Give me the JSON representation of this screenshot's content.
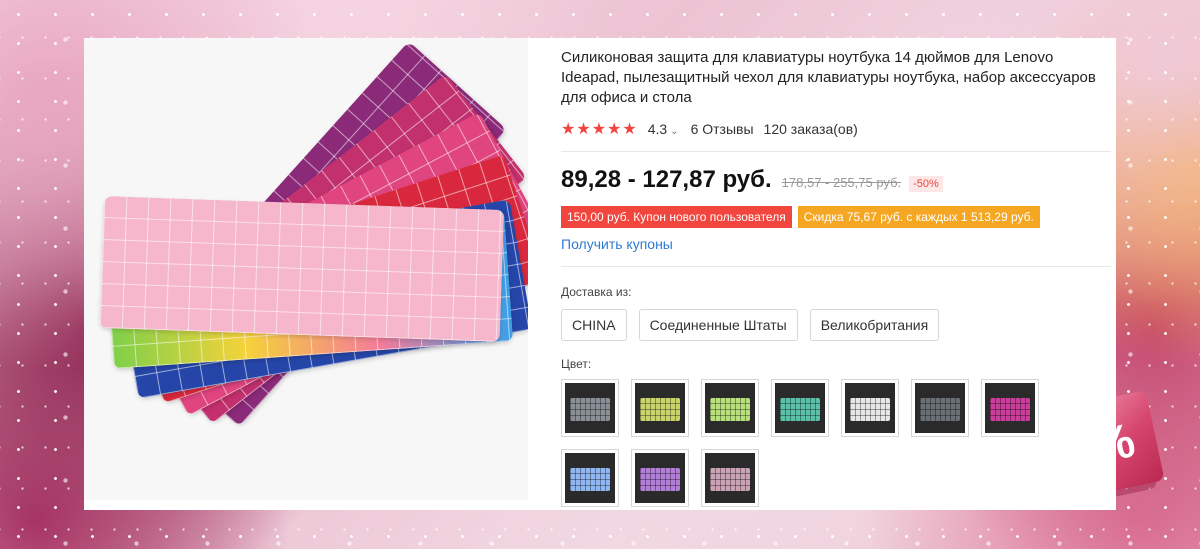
{
  "product": {
    "title": "Силиконовая защита для клавиатуры ноутбука 14 дюймов для Lenovo Ideapad, пылезащитный чехол для клавиатуры ноутбука, набор аксессуаров для офиса и стола",
    "rating": "4.3",
    "stars": "★★★★★",
    "reviews": "6 Отзывы",
    "orders": "120 заказа(ов)",
    "price": "89,28 - 127,87 руб.",
    "old_price": "178,57 - 255,75 руб.",
    "discount": "-50%",
    "coupon_new_user": "150,00 руб. Купон нового пользователя",
    "coupon_discount": "Скидка 75,67 руб. с каждых 1 513,29 руб.",
    "get_coupons": "Получить купоны",
    "shipping_label": "Доставка из:",
    "shipping_options": [
      "CHINA",
      "Соединенные Штаты",
      "Великобритания"
    ],
    "color_label": "Цвет:",
    "color_swatches": [
      {
        "icon": "swatch-clear",
        "color": "#8a8f96"
      },
      {
        "icon": "swatch-yellow-blue",
        "color": "#c8d46a"
      },
      {
        "icon": "swatch-lime-pink",
        "color": "#b7e07a"
      },
      {
        "icon": "swatch-rainbow",
        "color": "#5bc0a8"
      },
      {
        "icon": "swatch-white",
        "color": "#e6e6e6"
      },
      {
        "icon": "swatch-gray",
        "color": "#6a6e75"
      },
      {
        "icon": "swatch-magenta",
        "color": "#c93d9b"
      },
      {
        "icon": "swatch-light-blue",
        "color": "#8fb6f0"
      },
      {
        "icon": "swatch-purple-pink",
        "color": "#b27ed8"
      },
      {
        "icon": "swatch-pink-gray",
        "color": "#c9a2b4"
      }
    ]
  },
  "colors": {
    "accent_red": "#f1453d",
    "accent_orange": "#f5a623",
    "link_blue": "#2e7bd6"
  },
  "promo_badge": "%"
}
